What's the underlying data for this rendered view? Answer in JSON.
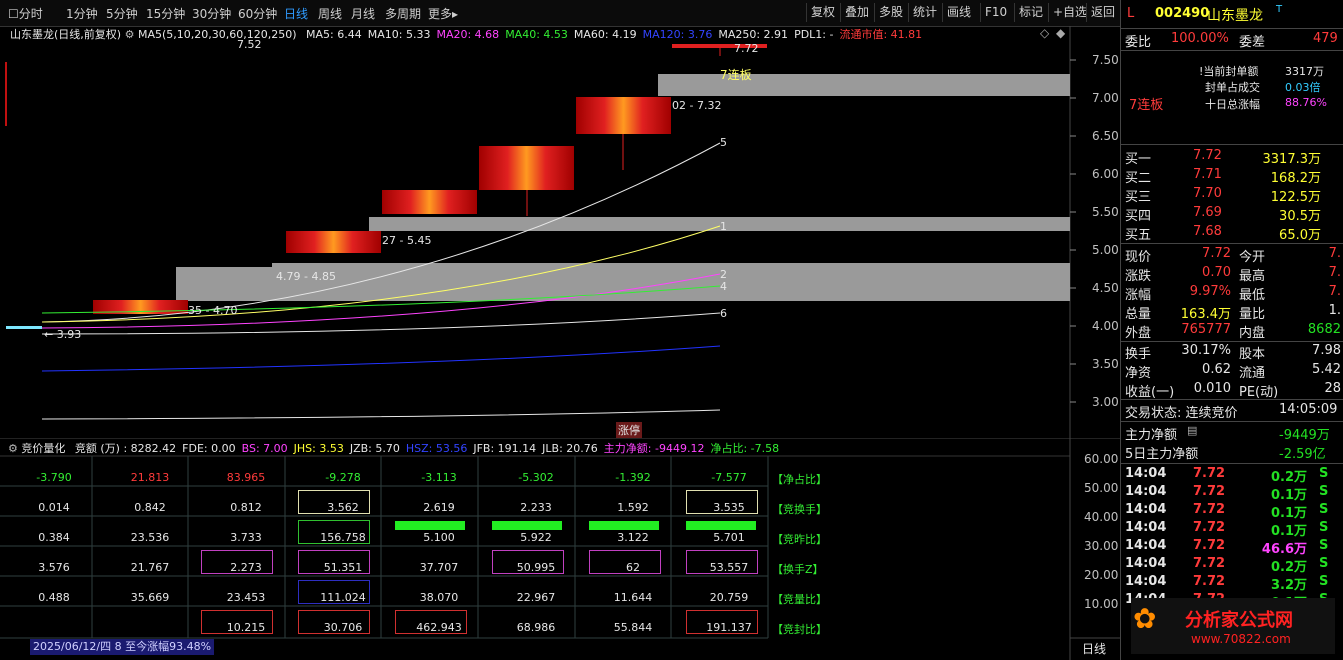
{
  "toolbar": {
    "periods": [
      "分时",
      "1分钟",
      "5分钟",
      "15分钟",
      "30分钟",
      "60分钟",
      "日线",
      "周线",
      "月线",
      "多周期",
      "更多"
    ],
    "active_period": "日线",
    "buttons": [
      "复权",
      "叠加",
      "多股",
      "统计",
      "画线",
      "F10",
      "标记",
      "+自选",
      "返回"
    ]
  },
  "chart": {
    "title": "山东墨龙(日线,前复权)",
    "ma_header": "MA5(5,10,20,30,60,120,250)",
    "ma": [
      {
        "label": "MA5: 6.44",
        "color": "#e6e6e6"
      },
      {
        "label": "MA10: 5.33",
        "color": "#e6e6e6"
      },
      {
        "label": "MA20: 4.68",
        "color": "#ff44ff"
      },
      {
        "label": "MA40: 4.53",
        "color": "#33ee33"
      },
      {
        "label": "MA60: 4.19",
        "color": "#e6e6e6"
      },
      {
        "label": "MA120: 3.76",
        "color": "#3344ff"
      },
      {
        "label": "MA250: 2.91",
        "color": "#e6e6e6"
      },
      {
        "label": "PDL1: -",
        "color": "#e6e6e6"
      },
      {
        "label": "流通市值: 41.81",
        "color": "#ff3b3b"
      }
    ],
    "price_ticks": [
      "7.50",
      "7.00",
      "6.50",
      "6.00",
      "5.50",
      "5.00",
      "4.50",
      "4.00",
      "3.50",
      "3.00"
    ],
    "annotations": {
      "top_value": "7.72",
      "limit_label": "7连板",
      "label_732": "02 - 7.32",
      "label_545": "27 - 5.45",
      "label_485": "4.79 - 4.85",
      "label_470": "35 - 4.70",
      "label_393": "3.93",
      "label_752": "7.52",
      "line5": "5",
      "line1": "1",
      "line2": "2",
      "line4": "4",
      "line6": "6",
      "bottom_tag": "涨停"
    }
  },
  "sub": {
    "indicator_name": "竞价量化",
    "header": [
      {
        "text": "竞额 (万) : 8282.42",
        "color": "#e6e6e6"
      },
      {
        "text": "FDE: 0.00",
        "color": "#e6e6e6"
      },
      {
        "text": "BS: 7.00",
        "color": "#ff44ff"
      },
      {
        "text": "JHS: 3.53",
        "color": "#ffff33"
      },
      {
        "text": "JZB: 5.70",
        "color": "#e6e6e6"
      },
      {
        "text": "HSZ: 53.56",
        "color": "#3344ff"
      },
      {
        "text": "JFB: 191.14",
        "color": "#e6e6e6"
      },
      {
        "text": "JLB: 20.76",
        "color": "#e6e6e6"
      },
      {
        "text": "主力净额: -9449.12",
        "color": "#ff44ff"
      },
      {
        "text": "净占比: -7.58",
        "color": "#33ee33"
      }
    ],
    "rows": [
      [
        "-3.790",
        "21.813",
        "83.965",
        "-9.278",
        "-3.113",
        "-5.302",
        "-1.392",
        "-7.577"
      ],
      [
        "0.014",
        "0.842",
        "0.812",
        "3.562",
        "2.619",
        "2.233",
        "1.592",
        "3.535"
      ],
      [
        "0.384",
        "23.536",
        "3.733",
        "156.758",
        "5.100",
        "5.922",
        "3.122",
        "5.701"
      ],
      [
        "3.576",
        "21.767",
        "2.273",
        "51.351",
        "37.707",
        "50.995",
        "62",
        "53.557"
      ],
      [
        "0.488",
        "35.669",
        "23.453",
        "111.024",
        "38.070",
        "22.967",
        "11.644",
        "20.759"
      ],
      [
        "",
        "",
        "10.215",
        "30.706",
        "462.943",
        "68.986",
        "55.844",
        "191.137"
      ]
    ],
    "row_labels": [
      "【净占比】",
      "【竞换手】",
      "【竞昨比】",
      "【换手Z】",
      "【竞量比】",
      "【竞封比】"
    ],
    "y_ticks": [
      "60.00",
      "50.00",
      "40.00",
      "30.00",
      "20.00",
      "10.00"
    ],
    "status": "2025/06/12/四 8 至今涨幅93.48%",
    "period_tab": "日线"
  },
  "panel": {
    "code_prefix": "L",
    "code": "002490",
    "name": "山东墨龙",
    "name_sup": "T",
    "webi_label": "委比",
    "webi_value": "100.00%",
    "weicha_label": "委差",
    "weicha_value": "479",
    "seal_amount_label": "当前封单额",
    "seal_amount_value": "3317万",
    "seal_ratio_label": "封单占成交",
    "seal_ratio_value": "0.03倍",
    "limit_text": "7连板",
    "ten_day_label": "十日总涨幅",
    "ten_day_value": "88.76%",
    "bids": [
      {
        "label": "买一",
        "price": "7.72",
        "vol": "3317.3万"
      },
      {
        "label": "买二",
        "price": "7.71",
        "vol": "168.2万"
      },
      {
        "label": "买三",
        "price": "7.70",
        "vol": "122.5万"
      },
      {
        "label": "买四",
        "price": "7.69",
        "vol": "30.5万"
      },
      {
        "label": "买五",
        "price": "7.68",
        "vol": "65.0万"
      }
    ],
    "quote": [
      {
        "l1": "现价",
        "v1": "7.72",
        "l2": "今开",
        "v2": "7."
      },
      {
        "l1": "涨跌",
        "v1": "0.70",
        "l2": "最高",
        "v2": "7."
      },
      {
        "l1": "涨幅",
        "v1": "9.97%",
        "l2": "最低",
        "v2": "7."
      },
      {
        "l1": "总量",
        "v1": "163.4万",
        "l2": "量比",
        "v2": "1."
      },
      {
        "l1": "外盘",
        "v1": "765777",
        "l2": "内盘",
        "v2": "8682"
      }
    ],
    "fund": [
      {
        "l1": "换手",
        "v1": "30.17%",
        "l2": "股本",
        "v2": "7.98"
      },
      {
        "l1": "净资",
        "v1": "0.62",
        "l2": "流通",
        "v2": "5.42"
      },
      {
        "l1": "收益(一)",
        "v1": "0.010",
        "l2": "PE(动)",
        "v2": "28"
      }
    ],
    "trade_state_label": "交易状态: 连续竞价",
    "trade_time": "14:05:09",
    "main_net_label": "主力净额",
    "main_net_value": "-9449万",
    "five_day_label": "5日主力净额",
    "five_day_value": "-2.59亿",
    "ticks": [
      {
        "time": "14:04",
        "price": "7.72",
        "vol": "0.2万",
        "side": "S"
      },
      {
        "time": "14:04",
        "price": "7.72",
        "vol": "0.1万",
        "side": "S"
      },
      {
        "time": "14:04",
        "price": "7.72",
        "vol": "0.1万",
        "side": "S"
      },
      {
        "time": "14:04",
        "price": "7.72",
        "vol": "0.1万",
        "side": "S"
      },
      {
        "time": "14:04",
        "price": "7.72",
        "vol": "46.6万",
        "side": "S"
      },
      {
        "time": "14:04",
        "price": "7.72",
        "vol": "0.2万",
        "side": "S"
      },
      {
        "time": "14:04",
        "price": "7.72",
        "vol": "3.2万",
        "side": "S"
      },
      {
        "time": "14:04",
        "price": "7.72",
        "vol": "0.1万",
        "side": "S"
      }
    ],
    "watermark": "分析家公式网",
    "watermark_url": "www.70822.com"
  }
}
